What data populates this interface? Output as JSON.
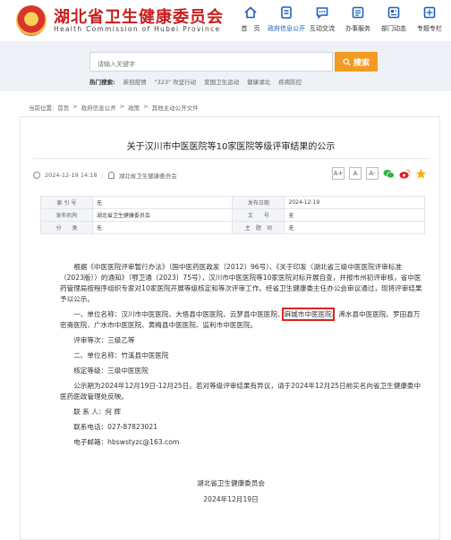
{
  "header": {
    "title": "湖北省卫生健康委员会",
    "subtitle": "Health Commission of Hubei Province",
    "nav": [
      {
        "label": "首　页",
        "icon": "home-icon",
        "active": false
      },
      {
        "label": "政府信息公开",
        "icon": "doc-icon",
        "active": true
      },
      {
        "label": "互动交流",
        "icon": "chat-icon",
        "active": false
      },
      {
        "label": "办事服务",
        "icon": "service-icon",
        "active": false
      },
      {
        "label": "部门动态",
        "icon": "news-icon",
        "active": false
      },
      {
        "label": "专题专栏",
        "icon": "topic-icon",
        "active": false
      }
    ]
  },
  "search": {
    "placeholder": "请输入关键字",
    "button_label": "搜索",
    "hot_label": "热门搜索:",
    "hot_terms": [
      "新冠疫情",
      "\"323\" 攻坚行动",
      "爱国卫生运动",
      "健康湖北",
      "疾病防控"
    ]
  },
  "breadcrumb": [
    "当前位置:",
    "首页",
    ">",
    "政府信息公开",
    ">",
    "政策",
    ">",
    "其他主动公开文件"
  ],
  "article": {
    "title": "关于汉川市中医医院等10家医院等级评审结果的公示",
    "date": "2024-12-19 14:18",
    "source": "湖北省卫生健康委员会",
    "font_buttons": [
      "A+",
      "A",
      "A-"
    ],
    "info": {
      "k1": "索 引 号",
      "v1": "无",
      "k2": "发布机构",
      "v2": "湖北省卫生健康委员会",
      "k3": "分　　类",
      "v3": "无",
      "k4": "发布日期",
      "v4": "2024-12-19",
      "k5": "文　　号",
      "v5": "无",
      "k6": "主　题　词",
      "v6": "无"
    },
    "p1": "根据《中医医院评审暂行办法》（国中医药医政发〔2012〕96号）、《关于印发〈湖北省三级中医医院评审标准（2023版）〉的通知》（鄂卫通〔2023〕75号），汉川市中医医院等10家医院对标开展自查，并报市州初评审核，省中医药管理局按程序组织专家对10家医院开展等级核定和等次评审工作。经省卫生健康委主任办公会审议通过，现将评审结果予以公示。",
    "p2a": "一、单位名称：汉川市中医医院、大悟县中医医院、云梦县中医医院、",
    "p2_highlight": "麻城市中医医院",
    "p2b": "、浠水县中医医院、罗田县万密斋医院、广水市中医医院、黄梅县中医医院、监利市中医医院。",
    "p3": "评审等次：三级乙等",
    "p4": "二、单位名称：竹溪县中医医院",
    "p5": "核定等级：三级中医医院",
    "p6": "公示期为2024年12月19日-12月25日。若对等级评审结果有异议，请于2024年12月25日前实名向省卫生健康委中医药医政管理处反映。",
    "contact": "联 系 人：何 辉",
    "phone": "联系电话：027-87823021",
    "email": "电子邮箱：hbswstyzc@163.com",
    "signature": "湖北省卫生健康委员会",
    "sign_date": "2024年12月19日"
  },
  "colors": {
    "brand_red": "#c81e1e",
    "nav_blue": "#1d5fb8",
    "search_orange": "#f29b22",
    "highlight_red": "#e02020"
  }
}
